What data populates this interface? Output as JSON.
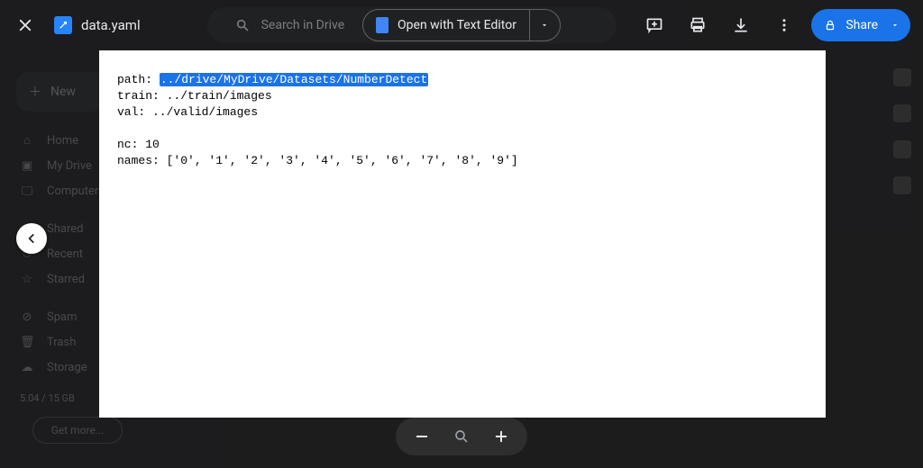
{
  "file": {
    "name": "data.yaml"
  },
  "search": {
    "placeholder": "Search in Drive"
  },
  "open_with": {
    "label": "Open with Text Editor"
  },
  "share": {
    "label": "Share"
  },
  "sidebar": {
    "new_label": "New",
    "items": [
      "Home",
      "My Drive",
      "Computers",
      "Shared",
      "Recent",
      "Starred",
      "Spam",
      "Trash",
      "Storage"
    ],
    "storage_line": "5.04 / 15 GB",
    "storage_btn": "Get more..."
  },
  "yaml": {
    "path_key": "path: ",
    "path_value": "../drive/MyDrive/Datasets/NumberDetect",
    "train": "train: ../train/images",
    "val": "val: ../valid/images",
    "nc": "nc: 10",
    "names": "names: ['0', '1', '2', '3', '4', '5', '6', '7', '8', '9']"
  }
}
